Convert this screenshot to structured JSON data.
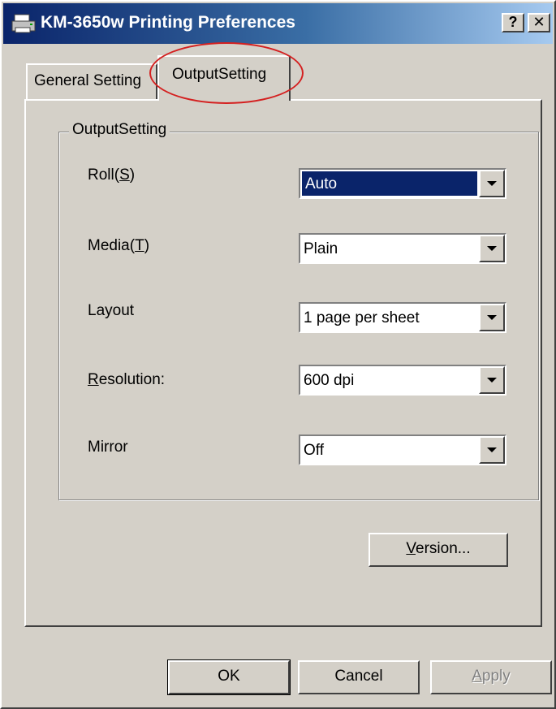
{
  "window": {
    "title": "KM-3650w Printing Preferences",
    "help_label": "?",
    "close_label": "✕"
  },
  "tabs": [
    {
      "label": "General Setting",
      "active": false
    },
    {
      "label": "OutputSetting",
      "active": true
    }
  ],
  "group": {
    "title": "OutputSetting",
    "rows": [
      {
        "label_prefix": "Roll(",
        "mnemonic": "S",
        "label_suffix": ")",
        "value": "Auto",
        "selected": true
      },
      {
        "label_prefix": "Media(",
        "mnemonic": "T",
        "label_suffix": ")",
        "value": "Plain"
      },
      {
        "label_prefix": "Layout",
        "mnemonic": "",
        "label_suffix": "",
        "value": "1 page per sheet"
      },
      {
        "label_prefix": "",
        "mnemonic": "R",
        "label_suffix": "esolution:",
        "value": "600 dpi"
      },
      {
        "label_prefix": "Mirror",
        "mnemonic": "",
        "label_suffix": "",
        "value": "Off"
      }
    ]
  },
  "buttons": {
    "version_mnemonic": "V",
    "version_rest": "ersion...",
    "ok": "OK",
    "cancel": "Cancel",
    "apply_mnemonic": "A",
    "apply_rest": "pply"
  },
  "colors": {
    "titlebar_start": "#0a246a",
    "titlebar_end": "#a6caf0",
    "face": "#d4d0c8",
    "highlight_circle": "#d42020"
  }
}
